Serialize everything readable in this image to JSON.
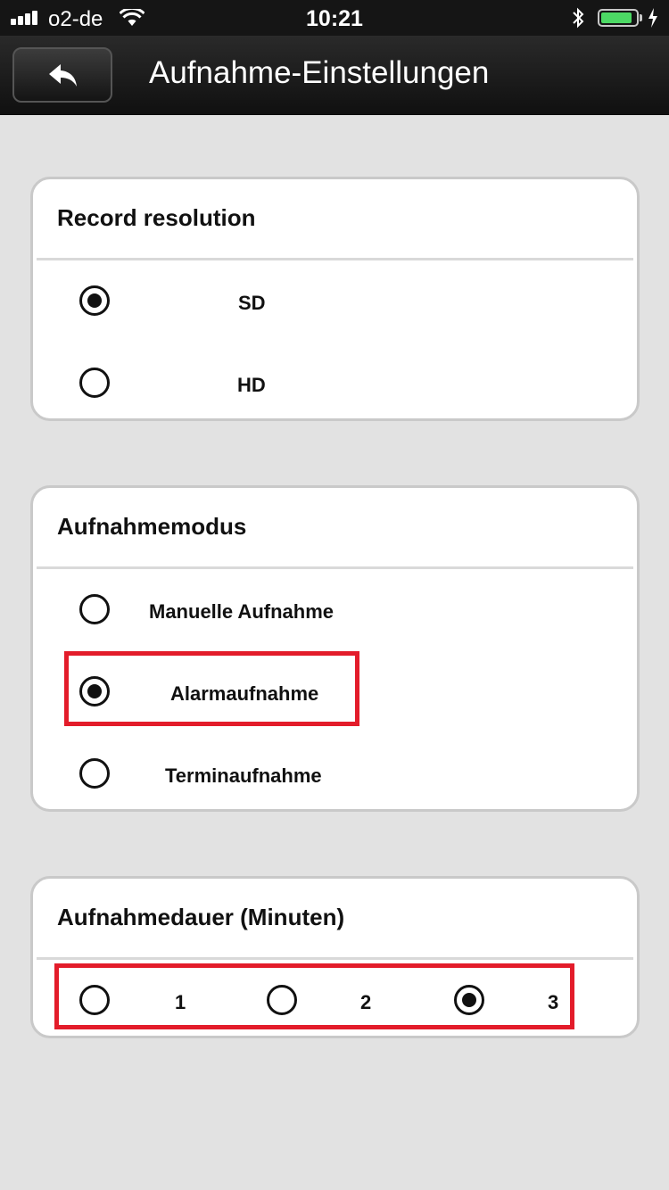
{
  "status_bar": {
    "carrier": "o2-de",
    "time": "10:21",
    "battery_level": 0.9,
    "battery_color": "#4cd964"
  },
  "nav": {
    "back_icon": "back-arrow-icon",
    "title": "Aufnahme-Einstellungen"
  },
  "sections": {
    "resolution": {
      "title": "Record resolution",
      "options": [
        {
          "label": "SD",
          "selected": true
        },
        {
          "label": "HD",
          "selected": false
        }
      ]
    },
    "mode": {
      "title": "Aufnahmemodus",
      "options": [
        {
          "label": "Manuelle Aufnahme",
          "selected": false
        },
        {
          "label": "Alarmaufnahme",
          "selected": true
        },
        {
          "label": "Terminaufnahme",
          "selected": false
        }
      ]
    },
    "duration": {
      "title": "Aufnahmedauer (Minuten)",
      "options": [
        {
          "label": "1",
          "selected": false
        },
        {
          "label": "2",
          "selected": false
        },
        {
          "label": "3",
          "selected": true
        }
      ]
    }
  },
  "colors": {
    "background": "#e2e2e2",
    "highlight": "#e31c2a"
  }
}
